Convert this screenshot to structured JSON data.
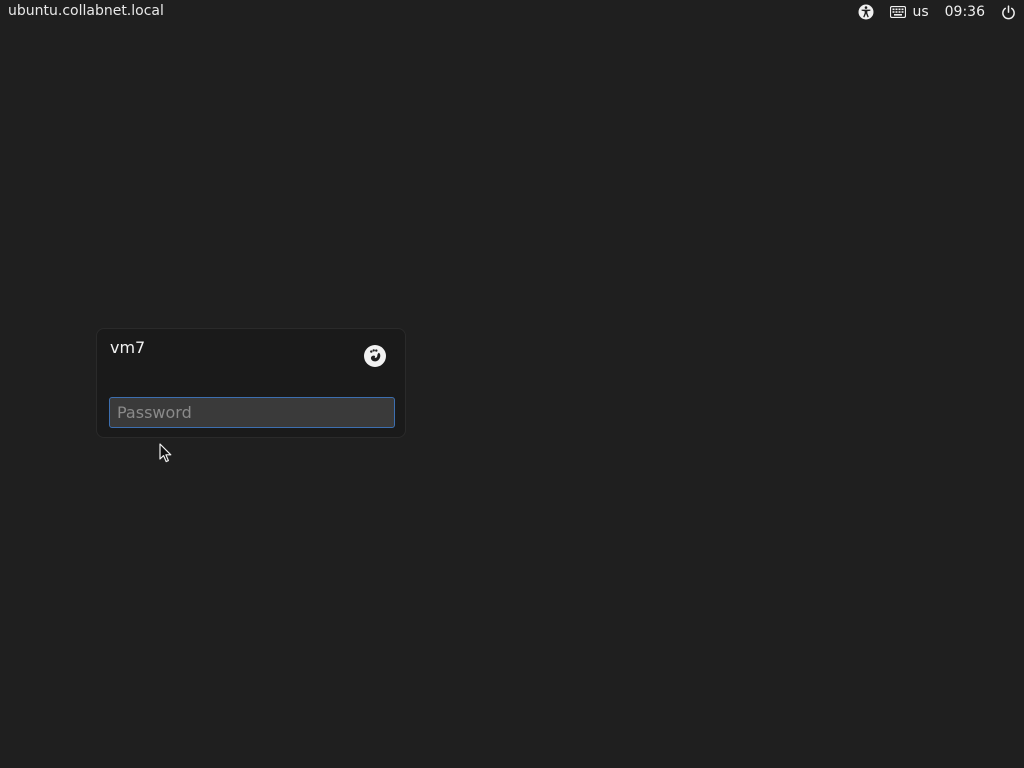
{
  "topbar": {
    "hostname": "ubuntu.collabnet.local",
    "accessibility_icon": "accessibility-icon",
    "keyboard_icon": "keyboard-icon",
    "keyboard_layout": "us",
    "clock": "09:36",
    "power_icon": "power-icon"
  },
  "login": {
    "username": "vm7",
    "session_icon": "gnome-foot-icon",
    "password_placeholder": "Password",
    "password_value": ""
  },
  "colors": {
    "background": "#1f1f1f",
    "accent": "#3d6fb0"
  }
}
